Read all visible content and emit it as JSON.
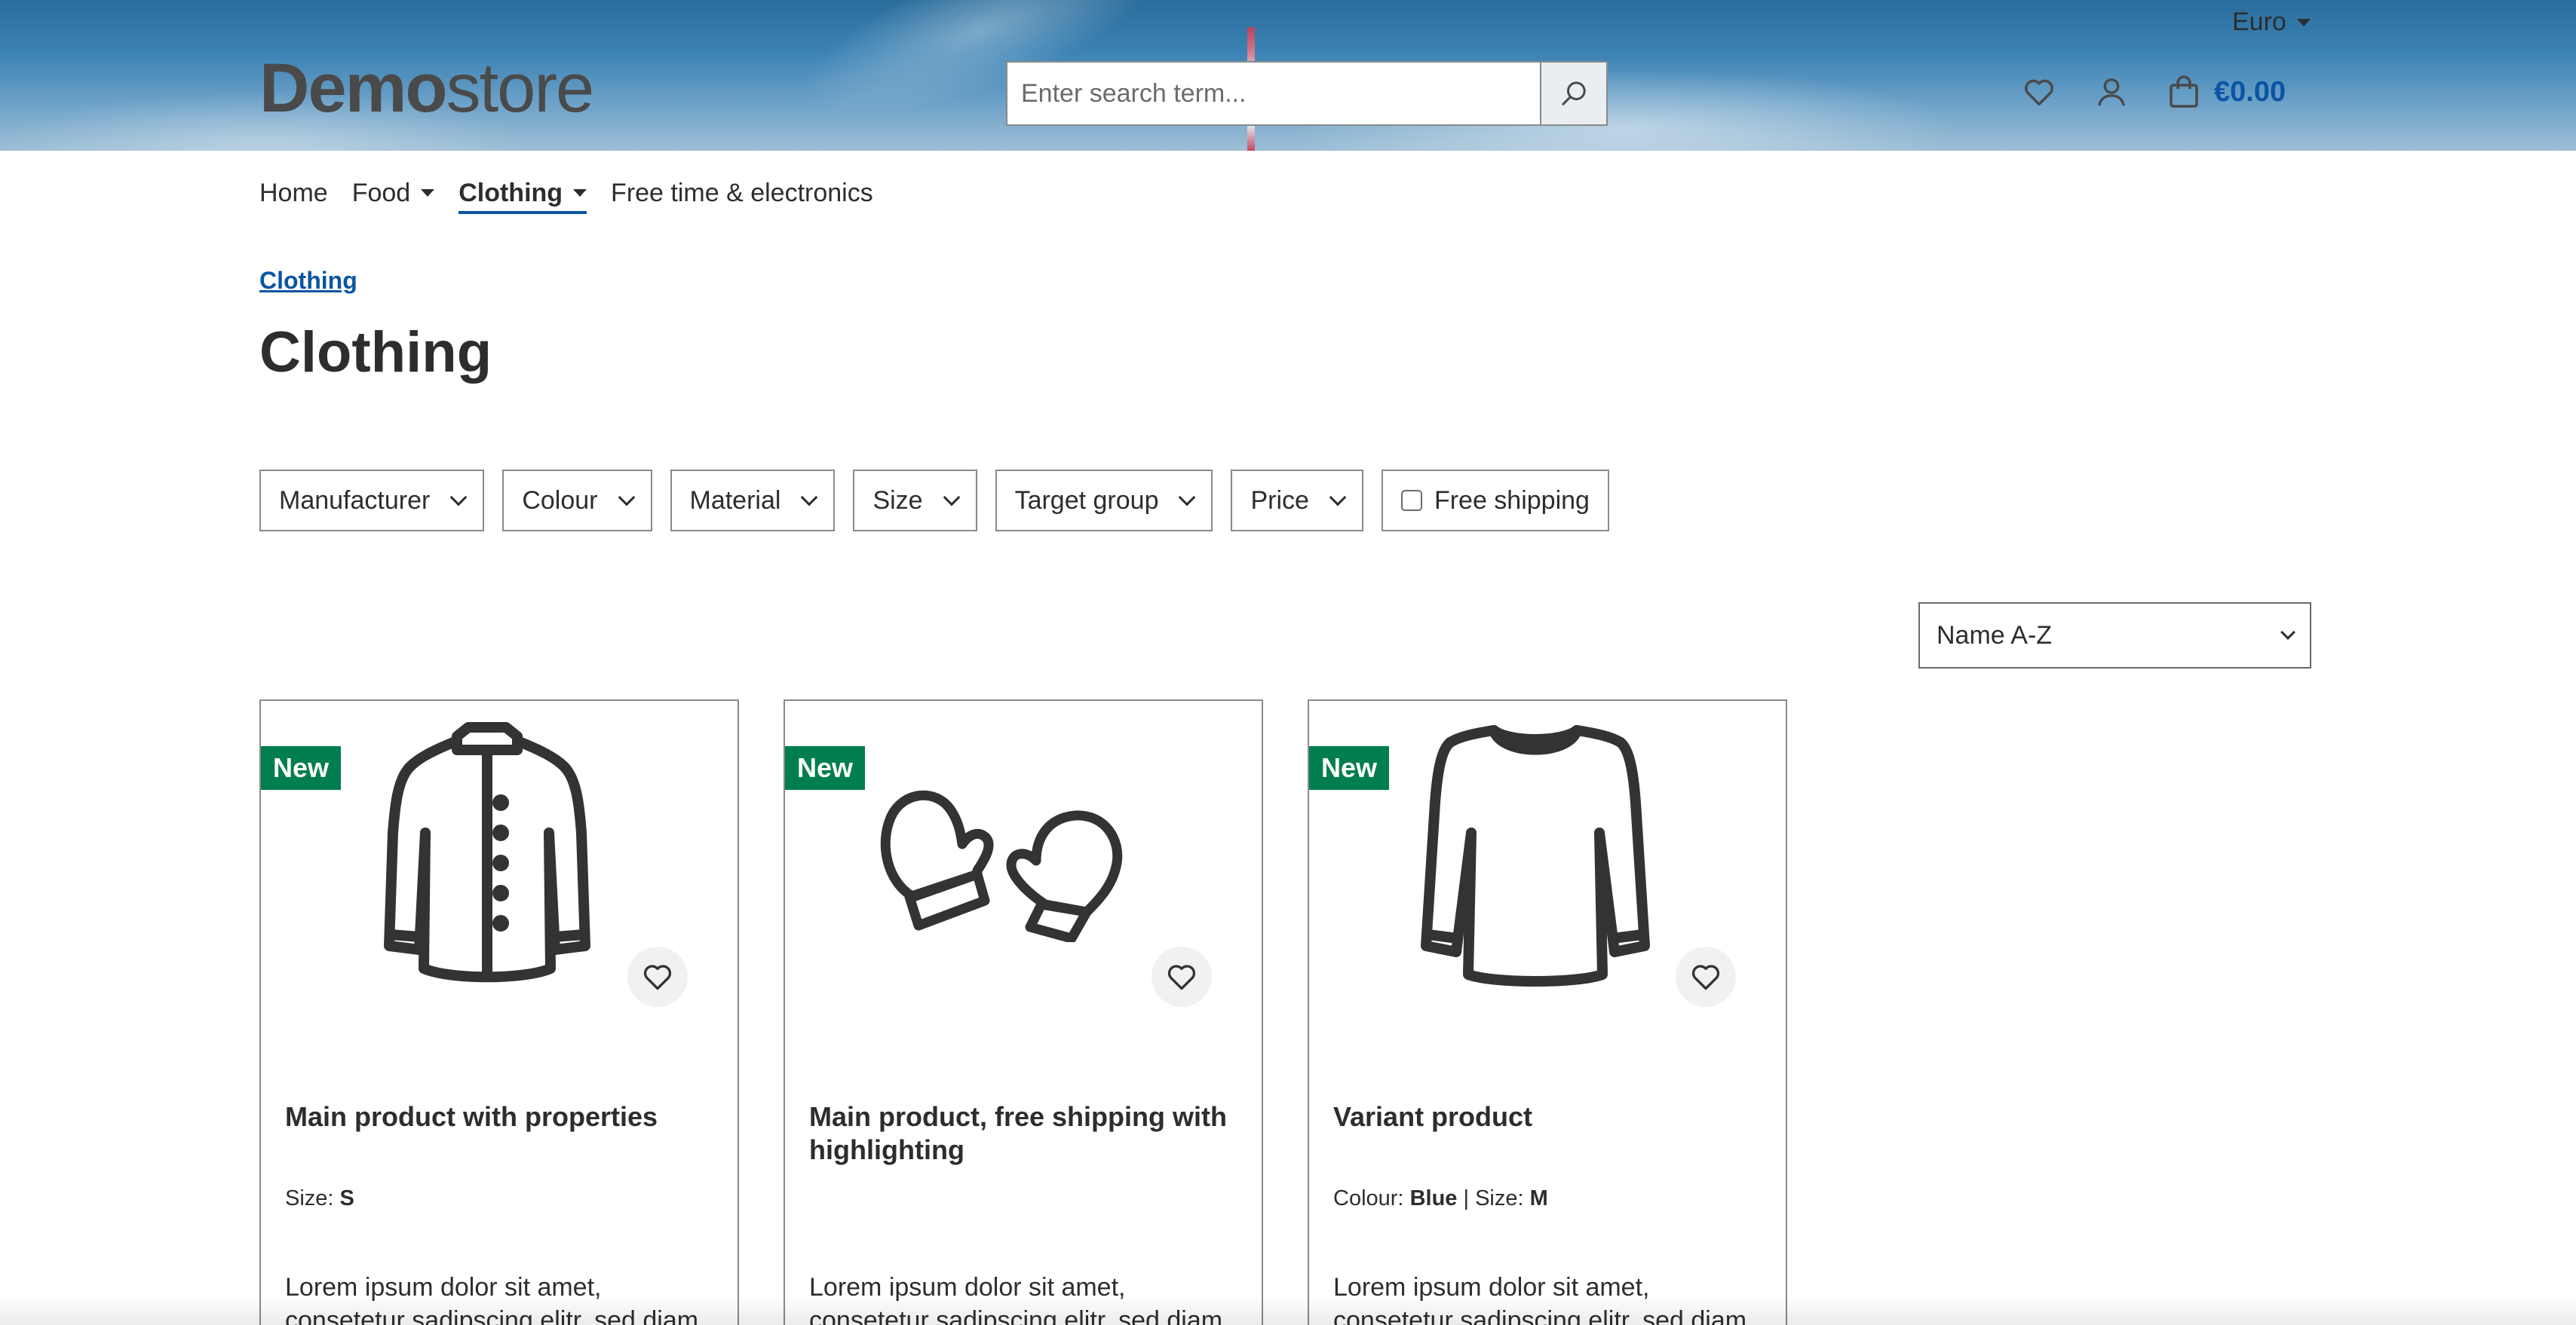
{
  "header": {
    "logo_bold": "Demo",
    "logo_light": "store",
    "currency": "Euro",
    "search_placeholder": "Enter search term...",
    "cart_total": "€0.00"
  },
  "nav": {
    "items": [
      {
        "label": "Home",
        "dropdown": false,
        "active": false
      },
      {
        "label": "Food",
        "dropdown": true,
        "active": false
      },
      {
        "label": "Clothing",
        "dropdown": true,
        "active": true
      },
      {
        "label": "Free time & electronics",
        "dropdown": false,
        "active": false
      }
    ]
  },
  "breadcrumb": "Clothing",
  "page_title": "Clothing",
  "filters": [
    {
      "label": "Manufacturer"
    },
    {
      "label": "Colour"
    },
    {
      "label": "Material"
    },
    {
      "label": "Size"
    },
    {
      "label": "Target group"
    },
    {
      "label": "Price"
    },
    {
      "label": "Free shipping",
      "type": "checkbox",
      "checked": false
    }
  ],
  "sort": {
    "selected": "Name A-Z"
  },
  "products": [
    {
      "badge": "New",
      "name": "Main product with properties",
      "icon": "jacket-icon",
      "props": [
        {
          "label": "Size:",
          "value": "S"
        }
      ],
      "desc": "Lorem ipsum dolor sit amet, consetetur sadipscing elitr, sed diam"
    },
    {
      "badge": "New",
      "name": "Main product, free shipping with highlighting",
      "icon": "mittens-icon",
      "props": [],
      "desc": "Lorem ipsum dolor sit amet, consetetur sadipscing elitr, sed diam"
    },
    {
      "badge": "New",
      "name": "Variant product",
      "icon": "sweater-icon",
      "props": [
        {
          "label": "Colour:",
          "value": "Blue"
        },
        {
          "label": "Size:",
          "value": "M"
        }
      ],
      "desc": "Lorem ipsum dolor sit amet, consetetur sadipscing elitr, sed diam"
    }
  ],
  "colors": {
    "accent": "#0b55a3",
    "badge_green": "#007e4e",
    "text": "#2d2d2d"
  }
}
